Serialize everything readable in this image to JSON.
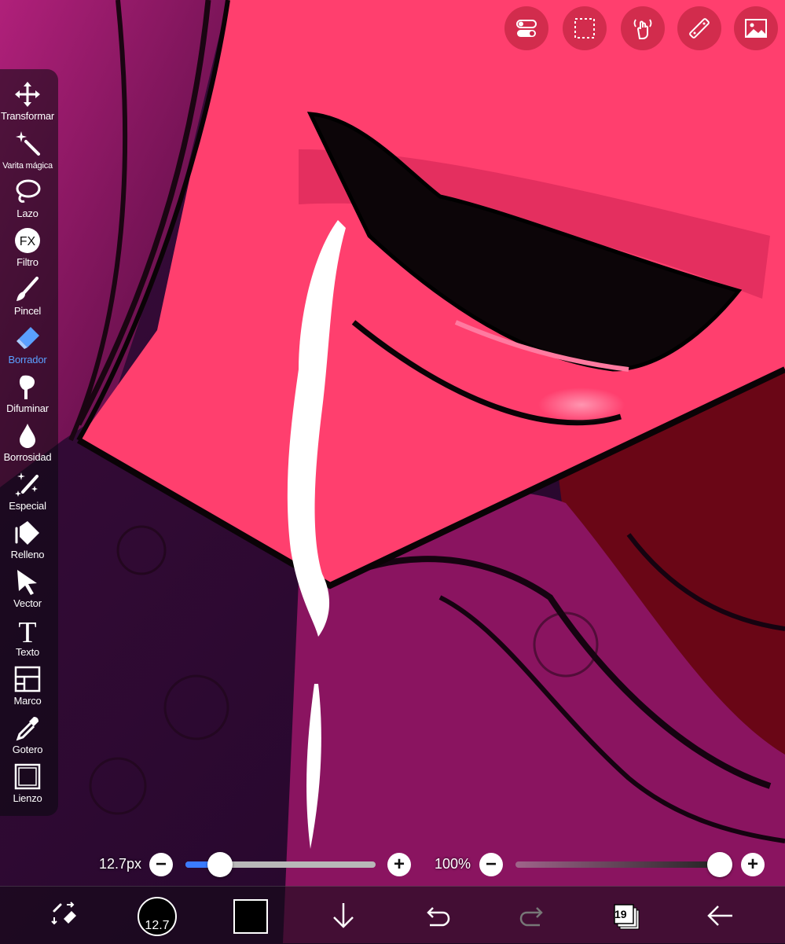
{
  "app": "ibisPaint",
  "top_buttons": [
    {
      "name": "settings-toggle-button",
      "icon": "toggles-icon"
    },
    {
      "name": "selection-button",
      "icon": "dashed-selection-icon"
    },
    {
      "name": "hand-button",
      "icon": "hand-gesture-icon"
    },
    {
      "name": "ruler-button",
      "icon": "ruler-icon"
    },
    {
      "name": "image-button",
      "icon": "image-icon"
    }
  ],
  "toolbar": {
    "active": "Borrador",
    "active_color": "#5aa0ff",
    "tools": [
      {
        "label": "Transformar",
        "icon": "move-arrows-icon"
      },
      {
        "label": "Varita mágica",
        "icon": "magic-wand-icon"
      },
      {
        "label": "Lazo",
        "icon": "lasso-icon"
      },
      {
        "label": "Filtro",
        "icon": "fx-icon"
      },
      {
        "label": "Pincel",
        "icon": "brush-icon"
      },
      {
        "label": "Borrador",
        "icon": "eraser-icon"
      },
      {
        "label": "Difuminar",
        "icon": "smudge-icon"
      },
      {
        "label": "Borrosidad",
        "icon": "drop-icon"
      },
      {
        "label": "Especial",
        "icon": "sparkle-pen-icon"
      },
      {
        "label": "Relleno",
        "icon": "bucket-icon"
      },
      {
        "label": "Vector",
        "icon": "arrow-cursor-icon"
      },
      {
        "label": "Texto",
        "icon": "text-t-icon"
      },
      {
        "label": "Marco",
        "icon": "frame-icon"
      },
      {
        "label": "Gotero",
        "icon": "eyedropper-icon"
      },
      {
        "label": "Lienzo",
        "icon": "canvas-icon"
      }
    ]
  },
  "brush_size": {
    "readout": "12.7px",
    "fraction": 0.18,
    "minus": "−",
    "plus": "+"
  },
  "opacity": {
    "readout": "100%",
    "fraction": 1.0,
    "minus": "−",
    "plus": "+"
  },
  "bottom_bar": {
    "brush_circle_value": "12.7",
    "current_color": "#000000",
    "layers_count": "19"
  },
  "colors": {
    "skin": "#ff3f6e",
    "hair_dark": "#4a0a3a",
    "hair_mid": "#9a1a6a",
    "accent_blue": "#3a7bff"
  }
}
